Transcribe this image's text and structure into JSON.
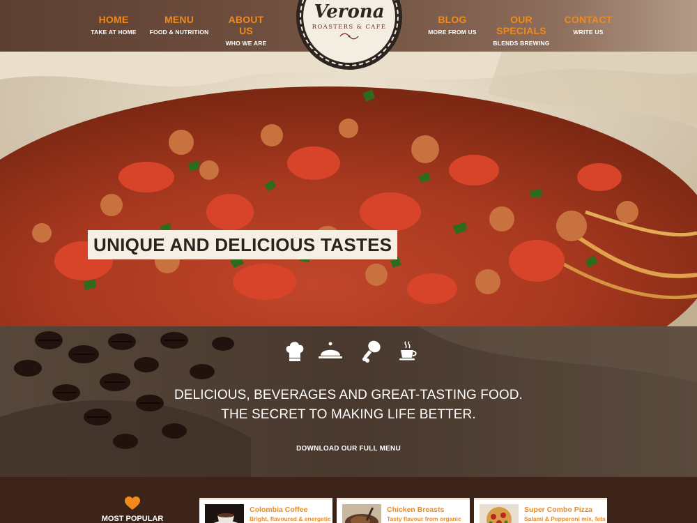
{
  "nav": {
    "left": [
      {
        "label": "HOME",
        "sub": "TAKE AT HOME"
      },
      {
        "label": "MENU",
        "sub": "FOOD & NUTRITION"
      },
      {
        "label": "ABOUT US",
        "sub": "WHO WE ARE"
      }
    ],
    "right": [
      {
        "label": "BLOG",
        "sub": "MORE FROM US"
      },
      {
        "label": "OUR SPECIALS",
        "sub": "BLENDS BREWING"
      },
      {
        "label": "CONTACT",
        "sub": "WRITE US"
      }
    ]
  },
  "logo": {
    "name": "Verona",
    "tagline": "ROASTERS & CAFE"
  },
  "hero": {
    "title": "UNIQUE AND DELICIOUS TASTES"
  },
  "features": {
    "icons": [
      "chef-hat-icon",
      "cloche-icon",
      "drumstick-icon",
      "coffee-cup-icon"
    ]
  },
  "tagline": {
    "line1": "DELICIOUS, BEVERAGES AND GREAT-TASTING FOOD.",
    "line2": "THE SECRET TO MAKING LIFE BETTER.",
    "cta": "DOWNLOAD OUR FULL MENU"
  },
  "popular": {
    "label": "MOST POPULAR",
    "icon": "heart-icon",
    "items": [
      {
        "title": "Colombia Coffee",
        "desc": "Bright, flavoured & energetic"
      },
      {
        "title": "Chicken Breasts",
        "desc": "Tasty flavour from organic"
      },
      {
        "title": "Super Combo Pizza",
        "desc": "Salami & Pepperoni mix, feta"
      }
    ]
  },
  "colors": {
    "accent": "#f08a1c",
    "header_bg": "#6d4d3d",
    "footer_bg": "#3d2418",
    "hero_label_bg": "#f5efe4"
  }
}
